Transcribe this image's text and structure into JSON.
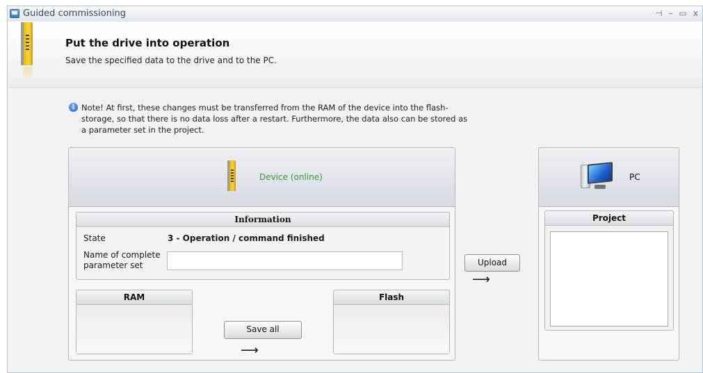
{
  "window": {
    "title": "Guided commissioning",
    "controls": {
      "pin": "⊣",
      "minimize": "–",
      "maximize": "▭",
      "close": "x"
    }
  },
  "header": {
    "title": "Put the drive into operation",
    "subtitle": "Save the specified data to the drive and to the PC.",
    "icon": "drive-icon"
  },
  "note": {
    "icon": "info-icon",
    "icon_glyph": "i",
    "text": "Note! At first, these changes must be transferred from the RAM of the device into the flash-storage, so that there is no data loss after a restart. Furthermore, the data also can be stored as a parameter set in the project."
  },
  "device": {
    "label": "Device (online)",
    "label_color": "#2e9e2e",
    "information": {
      "header": "Information",
      "state_label": "State",
      "state_value": "3 - Operation / command finished",
      "name_label": "Name of complete parameter set",
      "name_value": ""
    },
    "ram": {
      "header": "RAM"
    },
    "flash": {
      "header": "Flash"
    },
    "save_all_button": "Save all",
    "save_arrow": "⟶"
  },
  "transfer": {
    "upload_button": "Upload",
    "upload_arrow": "⟶"
  },
  "pc": {
    "label": "PC",
    "icon": "computer-icon",
    "project": {
      "header": "Project",
      "items": []
    }
  }
}
